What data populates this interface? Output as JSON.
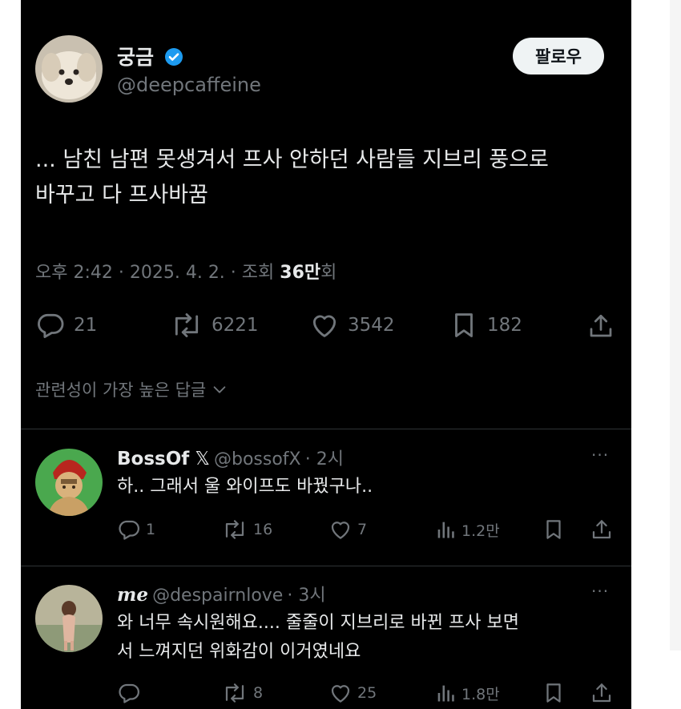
{
  "tweet": {
    "author_name": "궁금",
    "verified": true,
    "author_handle": "@deepcaffeine",
    "follow_label": "팔로우",
    "text_line1": "... 남친 남편 못생겨서 프사 안하던 사람들 지브리 풍으로",
    "text_line2": "바꾸고 다 프사바꿈",
    "meta_prefix": "오후 2:42 · 2025. 4. 2. · 조회 ",
    "views_bold": "36만",
    "views_suffix": "회",
    "replies": "21",
    "retweets": "6221",
    "likes": "3542",
    "bookmarks": "182"
  },
  "sort_label": "관련성이 가장 높은 답글",
  "replies": [
    {
      "name": "BossOf",
      "badge": "𝕏",
      "handle": "@bossofX",
      "time": "· 2시",
      "more": "···",
      "text": "하.. 그래서 울 와이프도 바꿨구나..",
      "replies": "1",
      "retweets": "16",
      "likes": "7",
      "views": "1.2만"
    },
    {
      "name": "me",
      "handle": "@despairnlove",
      "time": "· 3시",
      "more": "···",
      "text_line1": "와 너무 속시원해요.... 줄줄이 지브리로 바뀐 프사 보면",
      "text_line2": "서 느껴지던 위화감이 이거였네요",
      "replies": "",
      "retweets": "8",
      "likes": "25",
      "views": "1.8만"
    }
  ],
  "colors": {
    "background": "#000000",
    "text": "#e7e9ea",
    "muted": "#71767b",
    "verified": "#1d9bf0",
    "divider": "#2f3336"
  },
  "icons": [
    "reply-icon",
    "retweet-icon",
    "like-icon",
    "bookmark-icon",
    "share-icon",
    "views-icon",
    "verified-icon",
    "chevron-down-icon",
    "more-icon"
  ]
}
